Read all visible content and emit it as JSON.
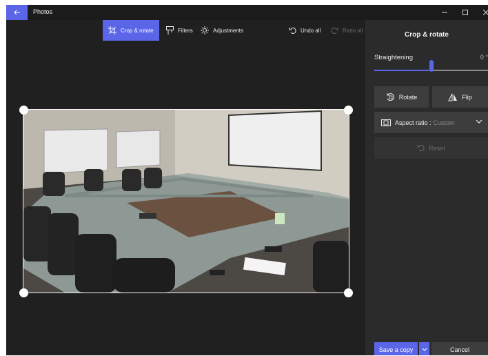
{
  "app": {
    "title": "Photos"
  },
  "toolbar": {
    "crop_rotate": "Crop & rotate",
    "filters": "Filters",
    "adjustments": "Adjustments",
    "undo_all": "Undo all",
    "redo_all": "Redo all"
  },
  "panel": {
    "title": "Crop & rotate",
    "straightening_label": "Straightening",
    "straightening_value": "0 °",
    "straightening_level": 0.5,
    "rotate": "Rotate",
    "flip": "Flip",
    "aspect_label": "Aspect ratio :",
    "aspect_value": "Custom",
    "reset": "Reset"
  },
  "footer": {
    "save_copy": "Save a copy",
    "cancel": "Cancel"
  },
  "colors": {
    "accent": "#5b65e8",
    "background": "#202020",
    "panel": "#2b2b2b"
  }
}
